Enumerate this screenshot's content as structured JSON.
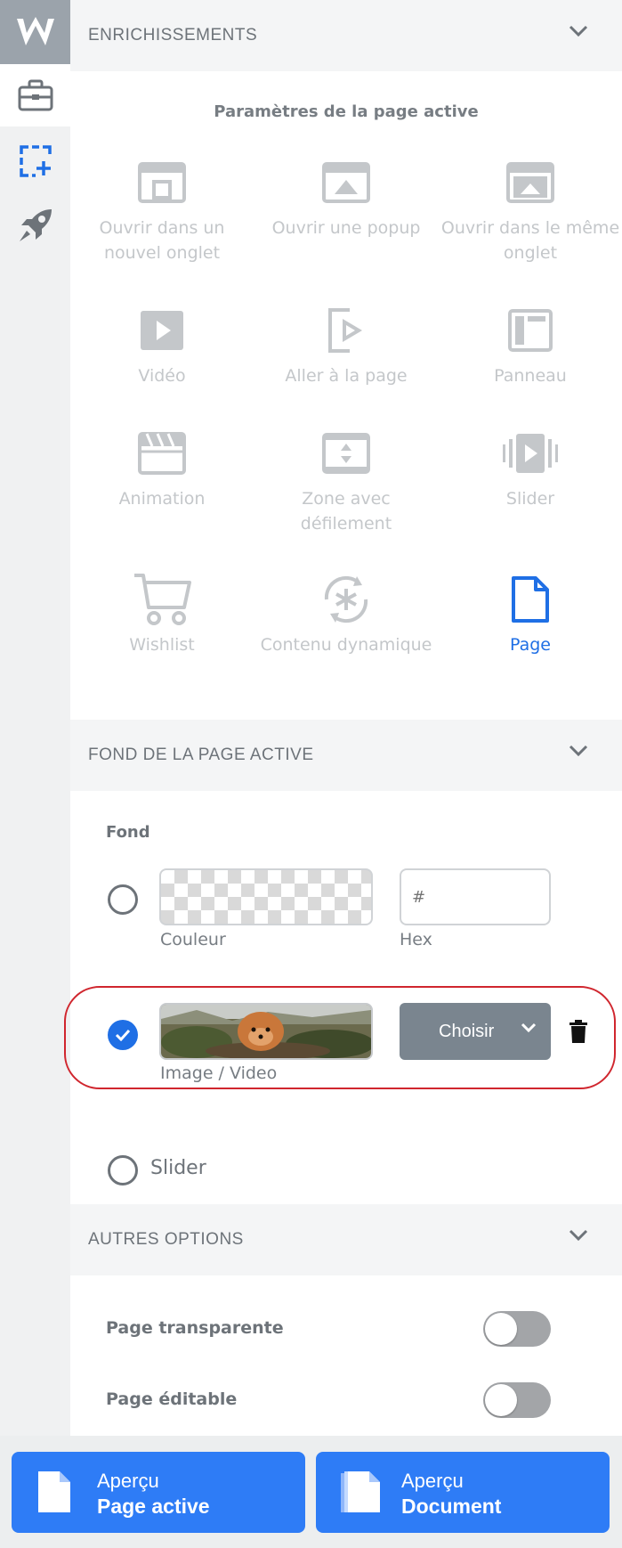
{
  "rail": {
    "icons": [
      "logo-w-icon",
      "briefcase-icon",
      "add-selection-icon",
      "rocket-icon"
    ]
  },
  "enrichments": {
    "header": "ENRICHISSEMENTS",
    "subtitle": "Paramètres de la page active",
    "tiles": [
      {
        "label": "Ouvrir dans un nouvel onglet",
        "icon": "new-tab-icon",
        "active": false
      },
      {
        "label": "Ouvrir une popup",
        "icon": "popup-icon",
        "active": false
      },
      {
        "label": "Ouvrir dans le même onglet",
        "icon": "same-tab-icon",
        "active": false
      },
      {
        "label": "Vidéo",
        "icon": "video-icon",
        "active": false
      },
      {
        "label": "Aller à la page",
        "icon": "go-to-page-icon",
        "active": false
      },
      {
        "label": "Panneau",
        "icon": "panel-icon",
        "active": false
      },
      {
        "label": "Animation",
        "icon": "clapperboard-icon",
        "active": false
      },
      {
        "label": "Zone avec défilement",
        "icon": "scroll-zone-icon",
        "active": false
      },
      {
        "label": "Slider",
        "icon": "slider-icon",
        "active": false
      },
      {
        "label": "Wishlist",
        "icon": "cart-icon",
        "active": false
      },
      {
        "label": "Contenu dynamique",
        "icon": "dynamic-content-icon",
        "active": false
      },
      {
        "label": "Page",
        "icon": "page-icon",
        "active": true
      }
    ]
  },
  "background": {
    "header": "FOND DE LA PAGE ACTIVE",
    "fond_label": "Fond",
    "color_label": "Couleur",
    "hex_placeholder": "#",
    "hex_label": "Hex",
    "image_label": "Image / Video",
    "choose_label": "Choisir",
    "slider_label": "Slider",
    "selected": "image"
  },
  "other_options": {
    "header": "AUTRES OPTIONS",
    "transparent_label": "Page transparente",
    "transparent_on": false,
    "editable_label": "Page éditable",
    "editable_on": false
  },
  "bottom": {
    "active_line1": "Aperçu",
    "active_line2": "Page active",
    "document_line1": "Aperçu",
    "document_line2": "Document"
  },
  "colors": {
    "accent": "#2e7cf6",
    "active_blue": "#1f6fe5",
    "highlight_red": "#d0262e"
  }
}
